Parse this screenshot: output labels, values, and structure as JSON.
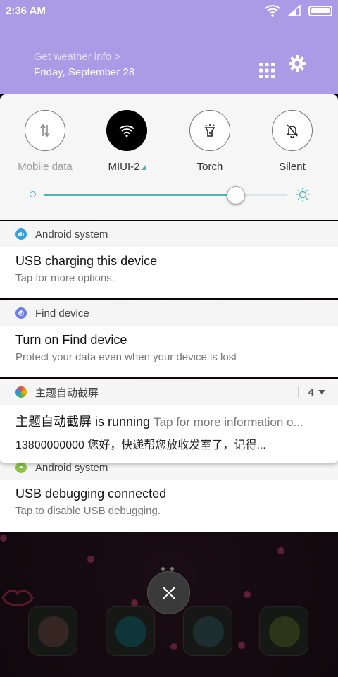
{
  "status_bar": {
    "time": "2:36 AM",
    "icons": [
      "wifi-icon",
      "signal-icon",
      "battery-icon"
    ]
  },
  "header": {
    "weather_link": "Get weather info >",
    "date": "Friday, September 28",
    "icons": [
      "grid-icon",
      "gear-icon"
    ]
  },
  "quick_toggles": [
    {
      "label": "Mobile data",
      "icon": "mobile-data-icon",
      "active": false,
      "dim": true
    },
    {
      "label": "MIUI-2",
      "icon": "wifi-icon",
      "active": true,
      "dim": false
    },
    {
      "label": "Torch",
      "icon": "torch-icon",
      "active": false,
      "dim": false
    },
    {
      "label": "Silent",
      "icon": "bell-off-icon",
      "active": false,
      "dim": false
    }
  ],
  "brightness": {
    "level_fraction": 0.79,
    "accent": "#48b8b3"
  },
  "notifications": [
    {
      "app": "Android system",
      "app_icon": "android-icon",
      "title": "USB charging this device",
      "text": "Tap for more options."
    },
    {
      "app": "Find device",
      "app_icon": "find-device-icon",
      "title": "Turn on Find device",
      "text": "Protect your data even when your device is lost"
    },
    {
      "app": "主题自动截屏",
      "app_icon": "theme-screenshot-icon",
      "count": "4",
      "title": "主题自动截屏 is running",
      "title_sub": "Tap for more information o...",
      "text": "13800000000 您好，快递帮您放收发室了，记得..."
    },
    {
      "app": "Android system",
      "app_icon": "android-icon",
      "title": "USB debugging connected",
      "text": "Tap to disable USB debugging."
    }
  ],
  "colors": {
    "header_bg": "#a99be6",
    "panel_bg": "#f6f6f6",
    "accent": "#48b8b3"
  }
}
